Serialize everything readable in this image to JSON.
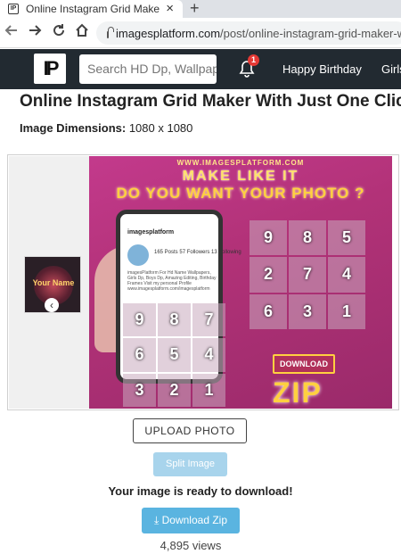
{
  "browser": {
    "tab_title": "Online Instagram Grid Maker Wi",
    "tab_close": "×",
    "new_tab": "+",
    "url_domain": "imagesplatform.com",
    "url_path": "/post/online-instagram-grid-maker-wi"
  },
  "site": {
    "logo_text": "IP",
    "search_placeholder": "Search HD Dp, Wallpape",
    "notification_count": "1",
    "nav_links": [
      "Happy Birthday",
      "Girls"
    ]
  },
  "main": {
    "title": "Online Instagram Grid Maker With Just One Click",
    "dimensions_label": "Image Dimensions:",
    "dimensions_value": "1080 x 1080",
    "poster": {
      "site": "WWW.IMAGESPLATFORM.COM",
      "line1": "MAKE LIKE IT",
      "line2": "DO YOU WANT YOUR PHOTO ?",
      "profile_name": "imagesplatform",
      "stats": "165 Posts   57 Followers   13 Following",
      "bio": "imagesPlatform For Hd Name Wallpapers, Girls Dp, Boys Dp, Amazing Editing, Birthday Frames Visit my personal Profile www.imagesplatform.com/imagesplatform",
      "grid_top": [
        "9",
        "8",
        "5",
        "2",
        "7",
        "4",
        "6",
        "3",
        "1"
      ],
      "grid_bottom": [
        "9",
        "8",
        "7",
        "6",
        "5",
        "4",
        "3",
        "2",
        "1"
      ],
      "download_label": "DOWNLOAD",
      "zip_label": "ZIP"
    },
    "thumbnail_name": "Your Name",
    "upload_button": "UPLOAD PHOTO",
    "split_button": "Split Image",
    "ready_text": "Your image is ready to download!",
    "download_button": "⤓ Download Zip",
    "views": "4,895 views"
  },
  "colors": {
    "nav_bg": "#222a31",
    "accent_blue": "#5ab4e0",
    "split_disabled": "#a8d4ec",
    "poster_pink": "#b23278",
    "poster_yellow": "#ffd040"
  }
}
